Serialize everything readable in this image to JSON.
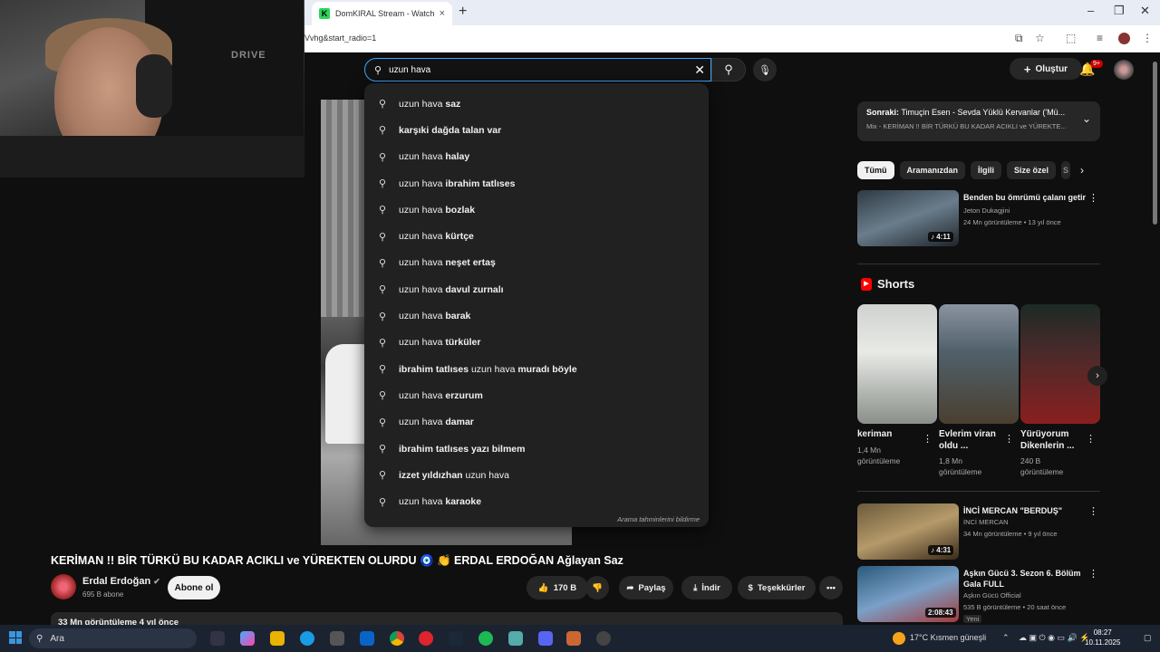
{
  "browser": {
    "tab_title": "DomKIRAL Stream - Watch Live",
    "tab_favicon": "K",
    "address": "Vvhg&start_radio=1",
    "new_tab": "+",
    "close_tab": "×"
  },
  "header": {
    "search_query": "uzun hava",
    "create_label": "Oluştur",
    "notif_count": "9+"
  },
  "suggestions": [
    {
      "prefix": "uzun hava ",
      "bold": "saz"
    },
    {
      "prefix": "",
      "bold": "karşıki dağda talan var"
    },
    {
      "prefix": "uzun hava ",
      "bold": "halay"
    },
    {
      "prefix": "uzun hava ",
      "bold": "ibrahim tatlıses"
    },
    {
      "prefix": "uzun hava ",
      "bold": "bozlak"
    },
    {
      "prefix": "uzun hava ",
      "bold": "kürtçe"
    },
    {
      "prefix": "uzun hava ",
      "bold": "neşet ertaş"
    },
    {
      "prefix": "uzun hava ",
      "bold": "davul zurnalı"
    },
    {
      "prefix": "uzun hava ",
      "bold": "barak"
    },
    {
      "prefix": "uzun hava ",
      "bold": "türküler"
    },
    {
      "prefix": "",
      "bold": "ibrahim tatlıses",
      "mid": " uzun hava ",
      "bold2": "muradı böyle"
    },
    {
      "prefix": "uzun hava ",
      "bold": "erzurum"
    },
    {
      "prefix": "uzun hava ",
      "bold": "damar"
    },
    {
      "prefix": "",
      "bold": "ibrahim tatlıses yazı bilmem"
    },
    {
      "prefix": "",
      "bold": "izzet yıldızhan",
      "mid": " uzun hava"
    },
    {
      "prefix": "uzun hava ",
      "bold": "karaoke"
    }
  ],
  "suggestions_report": "Arama tahminlerini bildirme",
  "video": {
    "title": "KERİMAN !! BİR TÜRKÜ BU KADAR ACIKLI ve YÜREKTEN OLURDU 🧿 👏 ERDAL ERDOĞAN Ağlayan Saz",
    "channel": "Erdal Erdoğan",
    "subscribers": "695 B abone",
    "subscribe_label": "Abone ol",
    "likes": "170 B",
    "share": "Paylaş",
    "download": "İndir",
    "thanks": "Teşekkürler",
    "views_date": "33 Mn görüntüleme  4 yıl önce"
  },
  "sidebar": {
    "next_label": "Sonraki:",
    "next_title": "Timuçin Esen - Sevda Yüklü Kervanlar ('Mü...",
    "next_sub": "Mix - KERİMAN !! BİR TÜRKÜ BU KADAR ACIKLI ve YÜREKTE...",
    "chips": [
      "Tümü",
      "Aramanızdan",
      "İlgili",
      "Size özel",
      "S"
    ],
    "rec1": {
      "title": "Benden bu ömrümü çalanı getir",
      "channel": "Jeton Dukagjini",
      "meta": "24 Mn görüntüleme • 13 yıl önce",
      "duration": "♪ 4:11"
    },
    "shorts_title": "Shorts",
    "shorts": [
      {
        "title": "keriman",
        "views": "1,4 Mn görüntüleme"
      },
      {
        "title": "Evlerim viran oldu ...",
        "views": "1,8 Mn görüntüleme"
      },
      {
        "title": "Yürüyorum Dikenlerin ...",
        "views": "240 B görüntüleme"
      }
    ],
    "rec2": {
      "title": "İNCİ MERCAN \"BERDUŞ\"",
      "channel": "İNCİ MERCAN",
      "meta": "34 Mn görüntüleme • 9 yıl önce",
      "duration": "♪ 4:31"
    },
    "rec3": {
      "title": "Aşkın Gücü 3. Sezon 6. Bölüm Gala FULL",
      "channel": "Aşkın Gücü Official",
      "meta": "535 B görüntüleme • 20 saat önce",
      "badge": "Yeni",
      "duration": "2:08:43"
    }
  },
  "taskbar": {
    "search_placeholder": "Ara",
    "weather": "17°C  Kısmen güneşli",
    "time": "08:27",
    "date": "10.11.2025"
  },
  "webcam": {
    "chair_brand": "DRIVE"
  }
}
